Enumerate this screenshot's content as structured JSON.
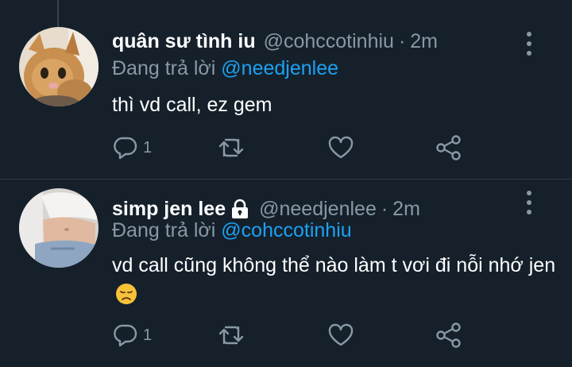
{
  "tweets": [
    {
      "display_name": "quân sư tình iu",
      "handle": "@cohccotinhiu",
      "separator": "·",
      "time": "2m",
      "reply_prefix": "Đang trả lời",
      "reply_to": "@needjenlee",
      "text": "thì vd call, ez gem",
      "reply_count": "1",
      "avatar": "cat-photo",
      "verified_lock": false
    },
    {
      "display_name": "simp jen lee",
      "handle": "@needjenlee",
      "separator": "·",
      "time": "2m",
      "reply_prefix": "Đang trả lời",
      "reply_to": "@cohccotinhiu",
      "text": "vd call cũng không thể nào làm t vơi đi nỗi nhớ jen",
      "emoji": "disappointed-face-emoji",
      "reply_count": "1",
      "avatar": "person-photo",
      "verified_lock": true
    }
  ],
  "colors": {
    "background": "#15202b",
    "secondary_text": "#8899a6",
    "mention": "#1da1f2",
    "divider": "#2f3a44"
  },
  "icons": [
    "reply-icon",
    "retweet-icon",
    "like-icon",
    "share-icon",
    "more-options-icon",
    "lock-icon"
  ]
}
